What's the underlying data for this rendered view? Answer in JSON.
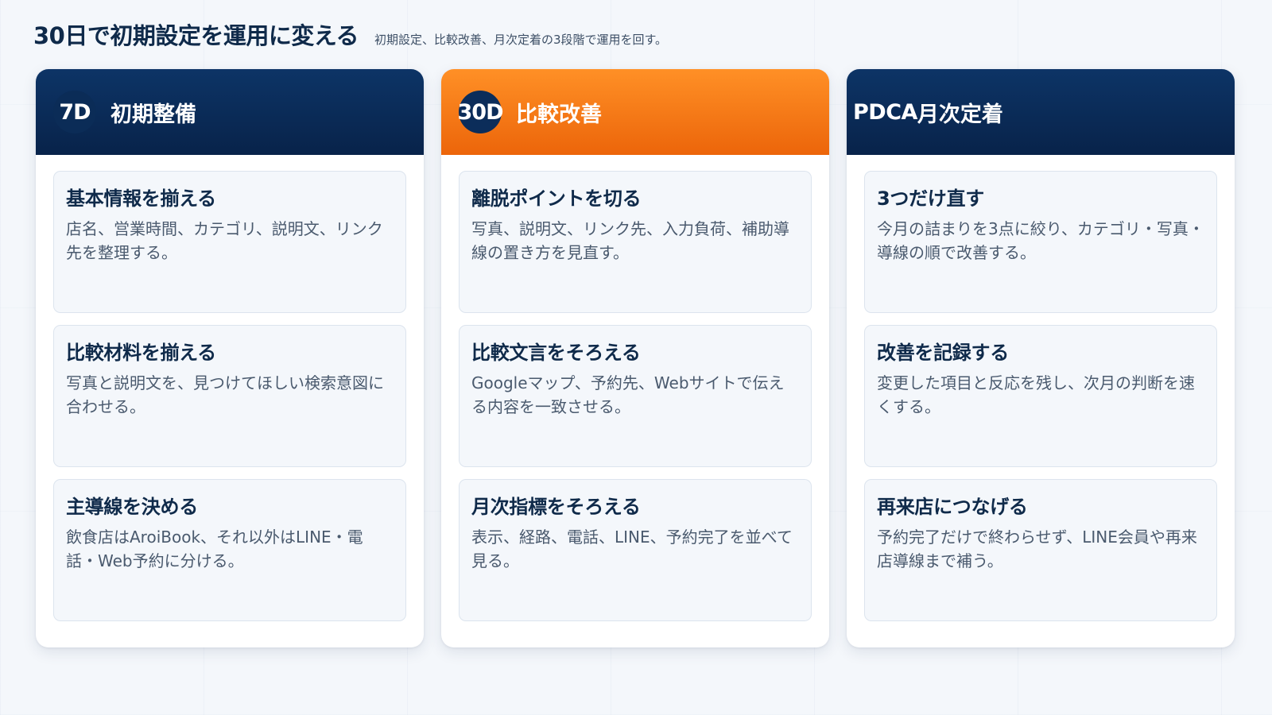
{
  "header": {
    "title": "30日で初期設定を運用に変える",
    "subtitle": "初期設定、比較改善、月次定着の3段階で運用を回す。"
  },
  "columns": [
    {
      "badge": "7D",
      "title": "初期整備",
      "color": "#0d3466",
      "cards": [
        {
          "title": "基本情報を揃える",
          "text": "店名、営業時間、カテゴリ、説明文、リンク先を整理する。"
        },
        {
          "title": "比較材料を揃える",
          "text": "写真と説明文を、見つけてほしい検索意図に合わせる。"
        },
        {
          "title": "主導線を決める",
          "text": "飲食店はAroiBook、それ以外はLINE・電話・Web予約に分ける。"
        }
      ]
    },
    {
      "badge": "30D",
      "title": "比較改善",
      "color": "#f07a14",
      "cards": [
        {
          "title": "離脱ポイントを切る",
          "text": "写真、説明文、リンク先、入力負荷、補助導線の置き方を見直す。"
        },
        {
          "title": "比較文言をそろえる",
          "text": "Googleマップ、予約先、Webサイトで伝える内容を一致させる。"
        },
        {
          "title": "月次指標をそろえる",
          "text": "表示、経路、電話、LINE、予約完了を並べて見る。"
        }
      ]
    },
    {
      "badge": "PDCA",
      "title": "月次定着",
      "color": "#0d3466",
      "cards": [
        {
          "title": "3つだけ直す",
          "text": "今月の詰まりを3点に絞り、カテゴリ・写真・導線の順で改善する。"
        },
        {
          "title": "改善を記録する",
          "text": "変更した項目と反応を残し、次月の判断を速くする。"
        },
        {
          "title": "再来店につなげる",
          "text": "予約完了だけで終わらせず、LINE会員や再来店導線まで補う。"
        }
      ]
    }
  ]
}
